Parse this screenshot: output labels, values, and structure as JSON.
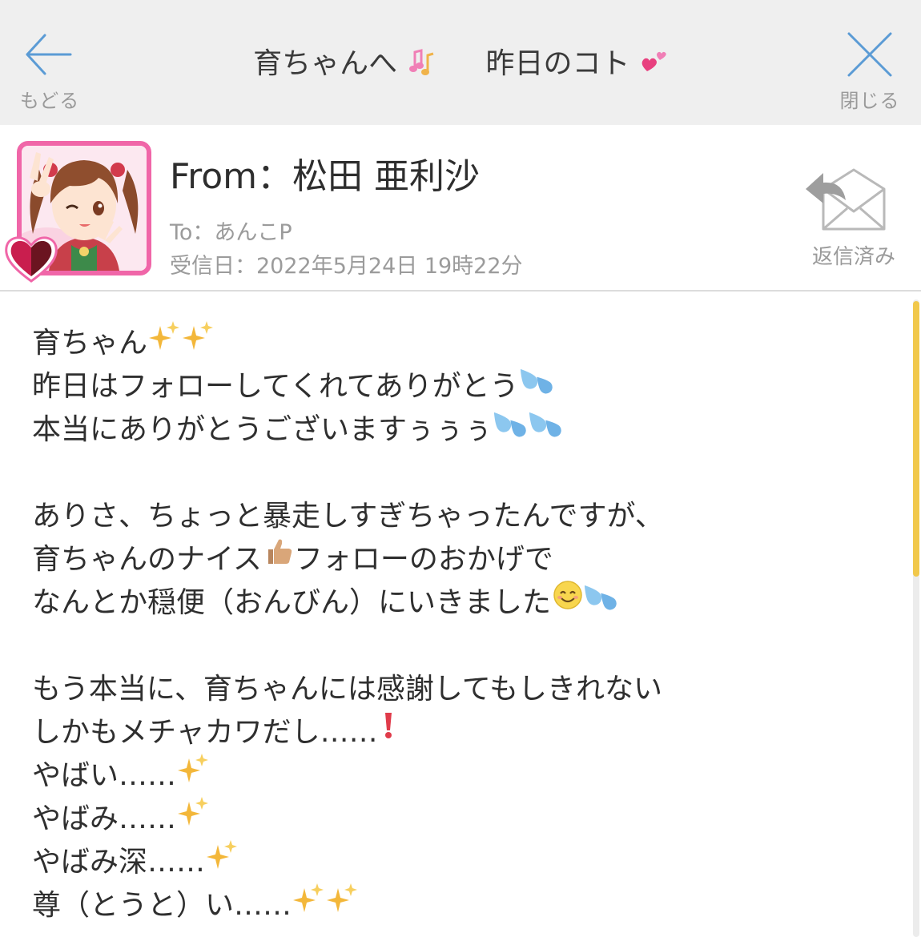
{
  "header": {
    "back_label": "もどる",
    "close_label": "閉じる",
    "title_part1": "育ちゃんへ",
    "title_part2": "昨日のコト"
  },
  "sender": {
    "from": "From：松田 亜利沙",
    "to": "To：あんこP",
    "received": "受信日：2022年5月24日 19時22分",
    "replied_label": "返信済み"
  },
  "message": {
    "lines": [
      {
        "text": "育ちゃん",
        "emoji": [
          "sparkles",
          "sparkles"
        ]
      },
      {
        "text": "昨日はフォローしてくれてありがとう",
        "emoji": [
          "sweat-drops"
        ]
      },
      {
        "text": "本当にありがとうございますぅぅぅ",
        "emoji": [
          "sweat-drops",
          "sweat-drops"
        ]
      },
      {
        "text": "",
        "emoji": []
      },
      {
        "text": "ありさ、ちょっと暴走しすぎちゃったんですが、",
        "emoji": []
      },
      {
        "text": "育ちゃんのナイス",
        "emoji": [
          "thumbs-up"
        ],
        "tail": "フォローのおかげで"
      },
      {
        "text": "なんとか穏便（おんびん）にいきました",
        "emoji": [
          "smiling-face",
          "sweat-drops"
        ]
      },
      {
        "text": "",
        "emoji": []
      },
      {
        "text": "もう本当に、育ちゃんには感謝してもしきれない",
        "emoji": []
      },
      {
        "text": "しかもメチャカワだし……",
        "emoji": [
          "exclamation-mark"
        ]
      },
      {
        "text": "やばい……",
        "emoji": [
          "sparkles"
        ]
      },
      {
        "text": "やばみ……",
        "emoji": [
          "sparkles"
        ]
      },
      {
        "text": "やばみ深……",
        "emoji": [
          "sparkles"
        ]
      },
      {
        "text": "尊（とうと）い……",
        "emoji": [
          "sparkles",
          "sparkles"
        ]
      }
    ]
  },
  "colors": {
    "header_bg": "#efefef",
    "accent_blue": "#5b9bd5",
    "avatar_border": "#f066a8",
    "scroll_thumb": "#f1c84b",
    "muted_text": "#9b9b9b"
  }
}
